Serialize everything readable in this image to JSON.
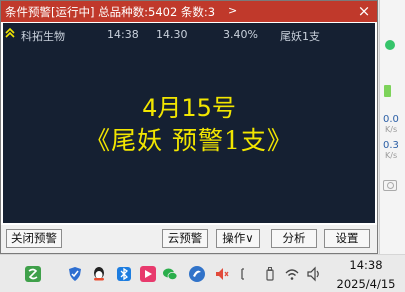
{
  "window": {
    "title": "条件预警[运行中] 总品种数:5402 条数:3",
    "more_label": ">",
    "close_label": "×"
  },
  "alerts": [
    {
      "name": "科拓生物",
      "time": "14:38",
      "price": "14.30",
      "change": "3.40%",
      "condition": "尾妖1支"
    }
  ],
  "banner": {
    "line1": "4月15号",
    "line2": "《尾妖 预警1支》"
  },
  "buttons": {
    "close_alert": "关闭预警",
    "cloud_alert": "云预警",
    "operations": "操作∨",
    "analysis": "分析",
    "settings": "设置"
  },
  "side_panel": {
    "upload_speed": "0.0",
    "upload_unit": "K/s",
    "download_speed": "0.3",
    "download_unit": "K/s"
  },
  "taskbar": {
    "time": "14:38",
    "date": "2025/4/15"
  },
  "colors": {
    "title_bar": "#c0392b",
    "list_background": "#152032",
    "banner_text": "#f2e600"
  }
}
